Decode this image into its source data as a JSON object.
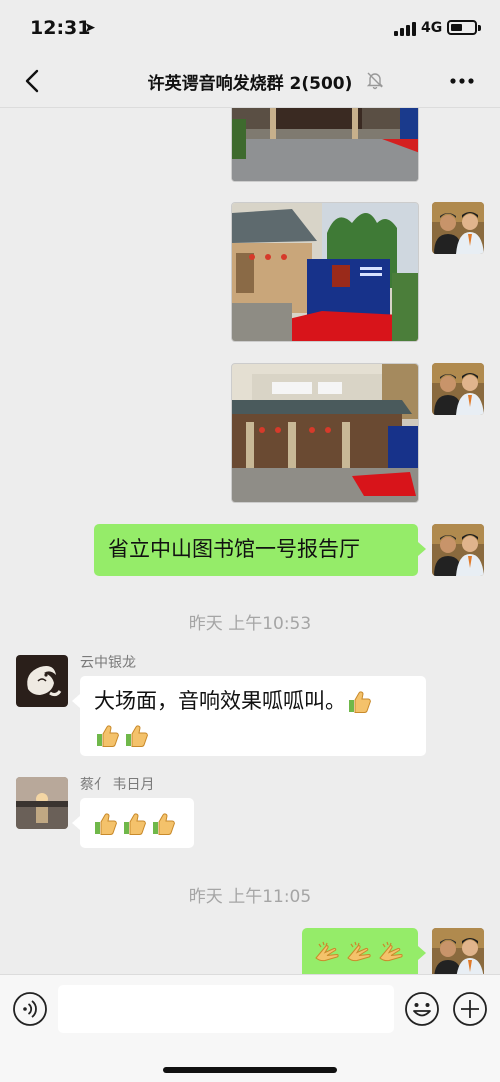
{
  "status_bar": {
    "time": "12:31",
    "network": "4G",
    "battery_level": 0.45
  },
  "nav": {
    "title": "许英谔音响发烧群 2(500)",
    "back_icon": "chevron-left-icon",
    "muted_icon": "bell-off-icon",
    "more_icon": "more-dots-icon"
  },
  "messages": {
    "m4_text": "省立中山图书馆一号报告厅",
    "ts1": "昨天 上午10:53",
    "m5_sender": "云中银龙",
    "m5_text": "大场面，音响效果呱呱叫。",
    "m6_sender": "蔡亻 韦日月",
    "ts2": "昨天 上午11:05"
  },
  "icons": {
    "thumbs_up": "thumbs-up-emoji",
    "clap": "clapping-hands-emoji"
  },
  "input": {
    "placeholder": "",
    "voice_icon": "voice-icon",
    "emoji_icon": "emoji-icon",
    "plus_icon": "plus-icon"
  },
  "colors": {
    "background": "#ededed",
    "bubble_outgoing": "#95ec69",
    "bubble_incoming": "#ffffff",
    "timestamp": "#a5a5a5"
  }
}
